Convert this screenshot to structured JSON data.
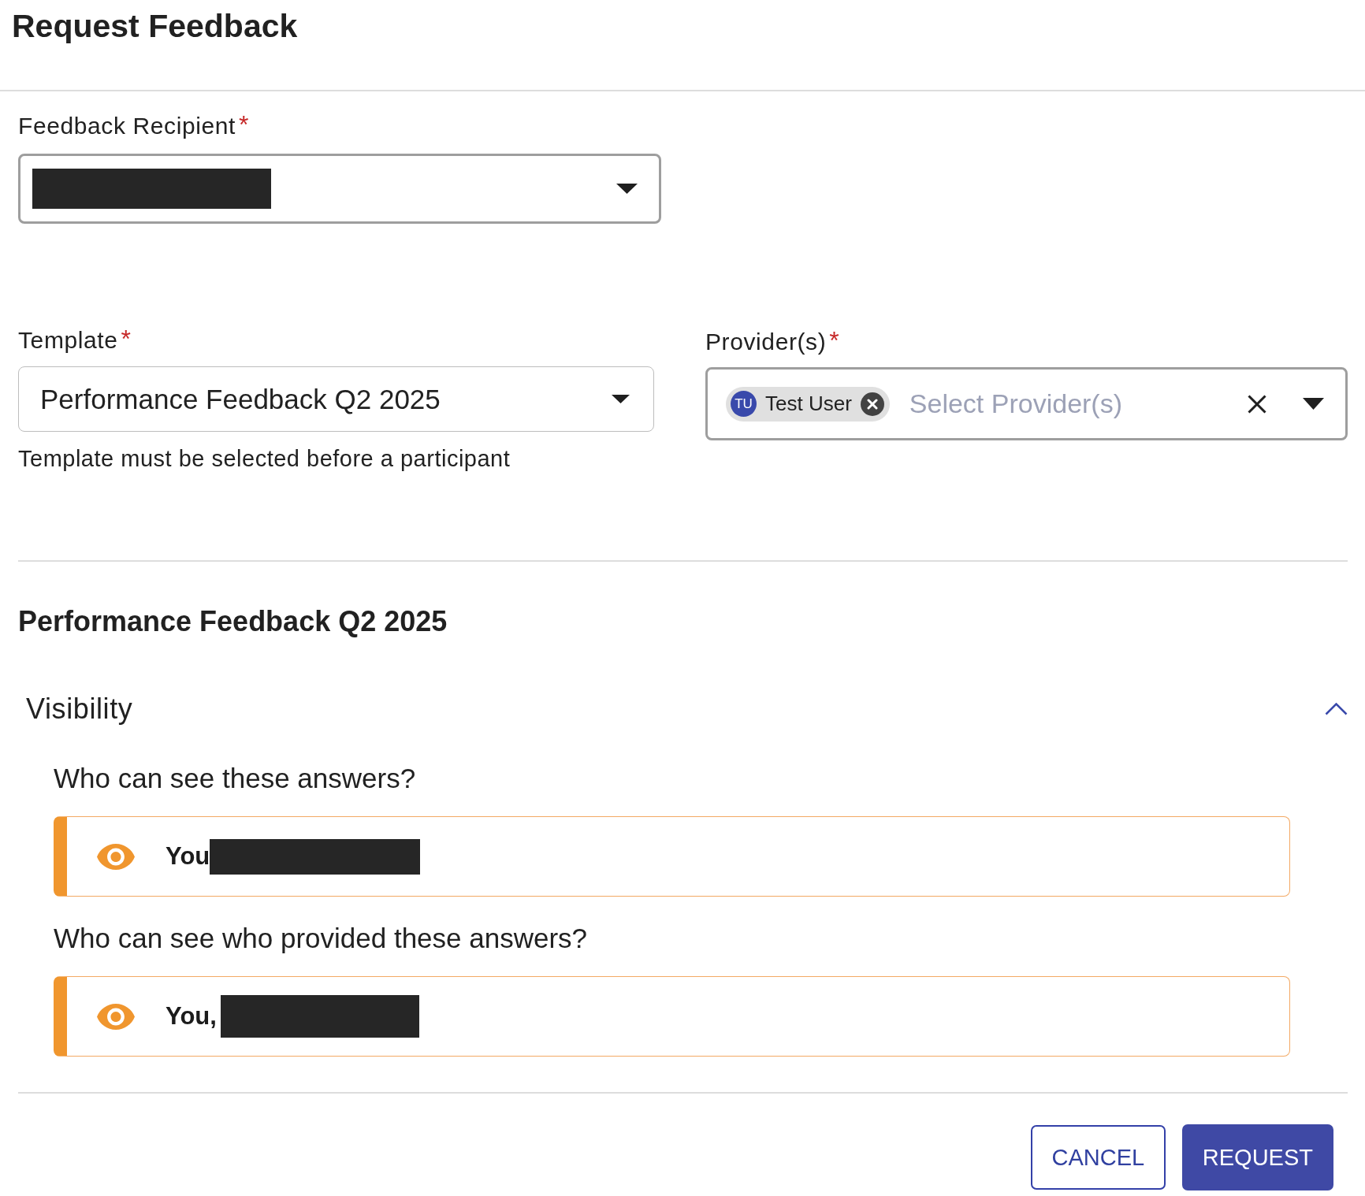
{
  "dialog": {
    "title": "Request Feedback"
  },
  "recipient": {
    "label": "Feedback Recipient",
    "required_mark": "*",
    "redacted": true
  },
  "template": {
    "label": "Template",
    "required_mark": "*",
    "value": "Performance Feedback Q2 2025",
    "helper": "Template must be selected before a participant"
  },
  "providers": {
    "label": "Provider(s)",
    "required_mark": "*",
    "chips": [
      {
        "initials": "TU",
        "name": "Test User"
      }
    ],
    "placeholder": "Select Provider(s)"
  },
  "template_section": {
    "title": "Performance Feedback Q2 2025",
    "visibility": {
      "title": "Visibility",
      "expanded": true,
      "questions": [
        {
          "question": "Who can see these answers?",
          "audience": "You",
          "redacted": true
        },
        {
          "question": "Who can see who provided these answers?",
          "audience": "You,",
          "redacted": true
        }
      ]
    }
  },
  "buttons": [
    {
      "label": "CANCEL",
      "kind": "outlined"
    },
    {
      "label": "REQUEST",
      "kind": "filled"
    }
  ]
}
